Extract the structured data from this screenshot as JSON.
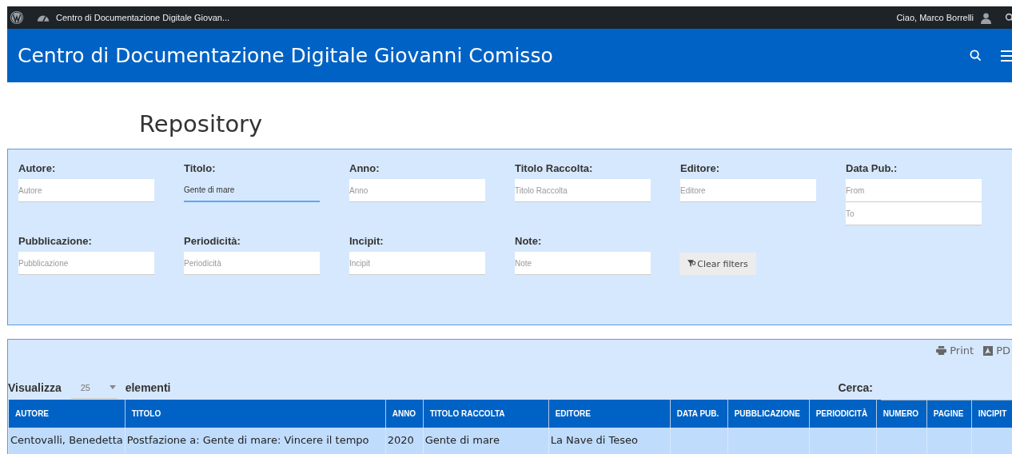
{
  "admin_bar": {
    "site_title": "Centro di Documentazione Digitale Giovan...",
    "greeting": "Ciao, Marco  Borrelli"
  },
  "header": {
    "title": "Centro di Documentazione Digitale Giovanni Comisso"
  },
  "page_title": "Repository",
  "filters": [
    {
      "label": "Autore:",
      "inputs": [
        {
          "placeholder": "Autore",
          "focused": false
        }
      ]
    },
    {
      "label": "Titolo:",
      "inputs": [
        {
          "value": "Gente di mare",
          "focused": true
        }
      ]
    },
    {
      "label": "Anno:",
      "inputs": [
        {
          "placeholder": "Anno",
          "focused": false
        }
      ]
    },
    {
      "label": "Titolo Raccolta:",
      "inputs": [
        {
          "placeholder": "Titolo Raccolta",
          "focused": false
        }
      ]
    },
    {
      "label": "Editore:",
      "inputs": [
        {
          "placeholder": "Editore",
          "focused": false
        }
      ]
    },
    {
      "label": "Data Pub.:",
      "inputs": [
        {
          "placeholder": "From",
          "focused": false
        },
        {
          "placeholder": "To",
          "focused": false
        }
      ]
    },
    {
      "label": "Pubblicazione:",
      "inputs": [
        {
          "placeholder": "Pubblicazione",
          "focused": false
        }
      ]
    },
    {
      "label": "Periodicità:",
      "inputs": [
        {
          "placeholder": "Periodicità",
          "focused": false
        }
      ]
    },
    {
      "label": "Incipit:",
      "inputs": [
        {
          "placeholder": "Incipit",
          "focused": false
        }
      ]
    },
    {
      "label": "Note:",
      "inputs": [
        {
          "placeholder": "Note",
          "focused": false
        }
      ]
    }
  ],
  "clear_button": "Clear filters",
  "export_buttons": [
    "Print",
    "PD"
  ],
  "length_menu": {
    "before": "Visualizza",
    "value": "25",
    "after": "elementi"
  },
  "search": {
    "label": "Cerca:"
  },
  "table": {
    "columns": [
      "AUTORE",
      "TITOLO",
      "ANNO",
      "TITOLO RACCOLTA",
      "EDITORE",
      "DATA PUB.",
      "PUBBLICAZIONE",
      "PERIODICITÀ",
      "NUMERO",
      "PAGINE",
      "INCIPIT"
    ],
    "rows": [
      [
        "Centovalli, Benedetta",
        "Postfazione a: Gente di mare: Vincere il tempo",
        "2020",
        "Gente di mare",
        "La Nave di Teseo",
        null,
        null,
        null,
        null,
        null,
        null
      ]
    ]
  }
}
